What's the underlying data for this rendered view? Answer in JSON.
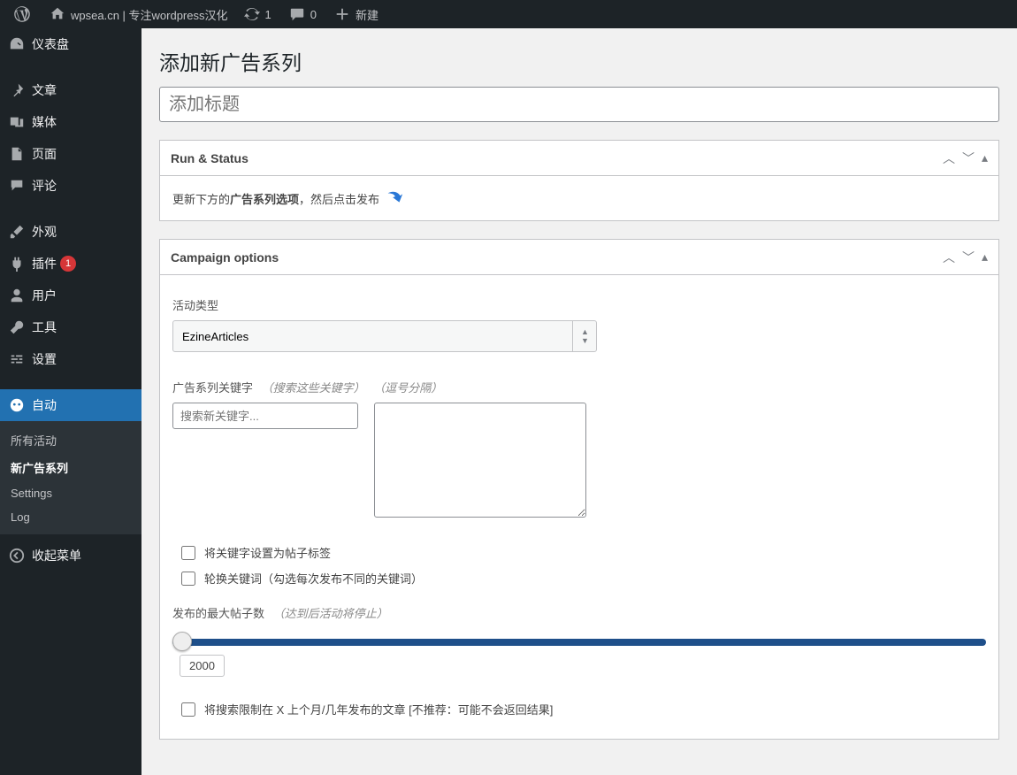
{
  "adminbar": {
    "site": "wpsea.cn | 专注wordpress汉化",
    "updates": "1",
    "comments": "0",
    "new": "新建"
  },
  "sidebar": {
    "dashboard": "仪表盘",
    "posts": "文章",
    "media": "媒体",
    "pages": "页面",
    "comments": "评论",
    "appearance": "外观",
    "plugins": "插件",
    "plugins_badge": "1",
    "users": "用户",
    "tools": "工具",
    "settings": "设置",
    "auto": "自动",
    "sub": {
      "all_campaigns": "所有活动",
      "new_campaign": "新广告系列",
      "settings": "Settings",
      "log": "Log"
    },
    "collapse": "收起菜单"
  },
  "page": {
    "heading": "添加新广告系列",
    "title_placeholder": "添加标题"
  },
  "runbox": {
    "title": "Run & Status",
    "text_before": "更新下方的",
    "text_bold": "广告系列选项",
    "text_after": "，然后点击发布"
  },
  "optbox": {
    "title": "Campaign options",
    "type_label": "活动类型",
    "type_value": "EzineArticles",
    "kw_label": "广告系列关键字",
    "kw_hint1": "（搜索这些关键字）",
    "kw_hint2": "（逗号分隔）",
    "kw_placeholder": "搜索新关键字...",
    "chk_tags": "将关键字设置为帖子标签",
    "chk_rotate": "轮换关键词（勾选每次发布不同的关键词）",
    "maxposts_label": "发布的最大帖子数",
    "maxposts_hint": "（达到后活动将停止）",
    "maxposts_value": "2000",
    "chk_limit": "将搜索限制在 X 上个月/几年发布的文章 [不推荐：可能不会返回结果]"
  }
}
